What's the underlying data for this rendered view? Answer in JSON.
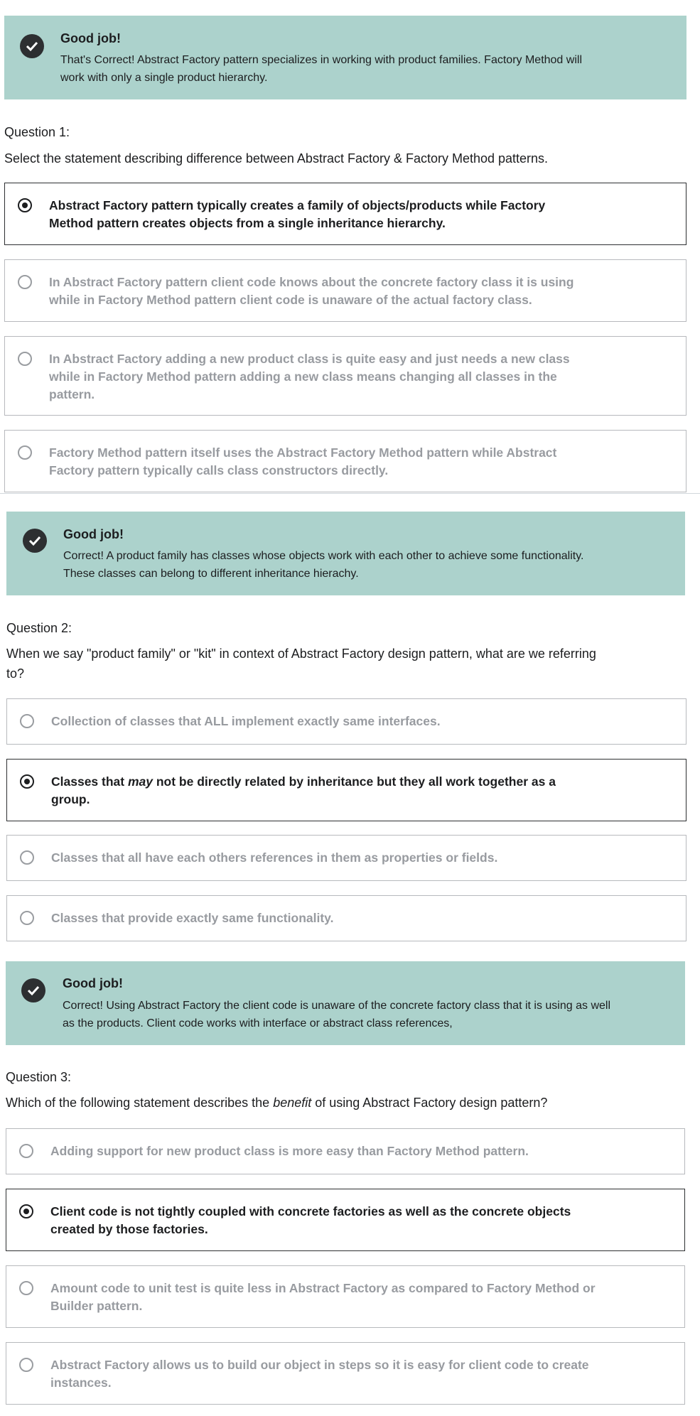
{
  "sections": [
    {
      "feedback": {
        "title": "Good job!",
        "text_line1": "That's Correct! Abstract Factory pattern specializes in working with product families. Factory Method will",
        "text_line2": "work with only a single product hierarchy."
      },
      "question_number": "Question 1:",
      "prompt": "Select the statement describing difference between Abstract Factory & Factory Method patterns.",
      "options": [
        {
          "line1": "Abstract Factory pattern typically creates a family of objects/products while Factory",
          "line2": "Method pattern creates objects from a single inheritance hierarchy.",
          "line3": "",
          "selected": true
        },
        {
          "line1": "In Abstract Factory pattern client code knows about the concrete factory class it is using",
          "line2": "while in Factory Method pattern client code is unaware of the actual factory class.",
          "line3": "",
          "selected": false
        },
        {
          "line1": "In Abstract Factory adding a new product class is quite easy and just needs a new class",
          "line2": "while in Factory Method pattern adding a new class means changing all classes in the",
          "line3": "pattern.",
          "selected": false
        },
        {
          "line1": "Factory Method pattern itself uses the Abstract Factory Method pattern while Abstract",
          "line2": "Factory pattern typically calls class constructors directly.",
          "line3": "",
          "selected": false
        }
      ]
    },
    {
      "feedback": {
        "title": "Good job!",
        "text_line1": "Correct! A product family has classes whose objects work with each other to achieve some functionality.",
        "text_line2": "These classes can belong to different inheritance hierachy."
      },
      "question_number": "Question 2:",
      "prompt_line1": "When we say \"product family\" or \"kit\" in context of Abstract Factory design pattern, what are we referring",
      "prompt_line2": "to?",
      "options": [
        {
          "line1": "Collection of classes that ALL implement exactly same interfaces.",
          "selected": false
        },
        {
          "line1_pre": "Classes that ",
          "line1_em": "may",
          "line1_post": " not be directly related by inheritance but they all work together as a",
          "line2": "group.",
          "selected": true
        },
        {
          "line1": "Classes that all have each others references in them as properties or fields.",
          "selected": false
        },
        {
          "line1": "Classes that provide exactly same functionality.",
          "selected": false
        }
      ]
    },
    {
      "feedback": {
        "title": "Good job!",
        "text_line1": "Correct! Using Abstract Factory the client code is unaware of the concrete factory class that it is using as well",
        "text_line2": "as the products. Client code works with interface or abstract class references,"
      },
      "question_number": "Question 3:",
      "prompt_pre": "Which of the following statement describes the ",
      "prompt_em": "benefit",
      "prompt_post": " of using Abstract Factory design pattern?",
      "options": [
        {
          "line1": "Adding support for new product class is more easy than Factory Method pattern.",
          "line2": "",
          "selected": false
        },
        {
          "line1": "Client code is not tightly coupled with concrete factories as well as the concrete objects",
          "line2": "created by those factories.",
          "selected": true
        },
        {
          "line1": "Amount code to unit test is quite less in Abstract Factory as compared to Factory Method or",
          "line2": "Builder pattern.",
          "selected": false
        },
        {
          "line1": "Abstract Factory allows us to build our object in steps so it is easy for client code to create",
          "line2": "instances.",
          "selected": false
        }
      ]
    }
  ],
  "icons": {
    "feedback_icon": "check-circle-icon",
    "option_icon": "radio-button-icon"
  },
  "colors": {
    "feedback_bg": "#acd2cc",
    "text": "#1c1d1f",
    "muted": "#989ba0"
  }
}
